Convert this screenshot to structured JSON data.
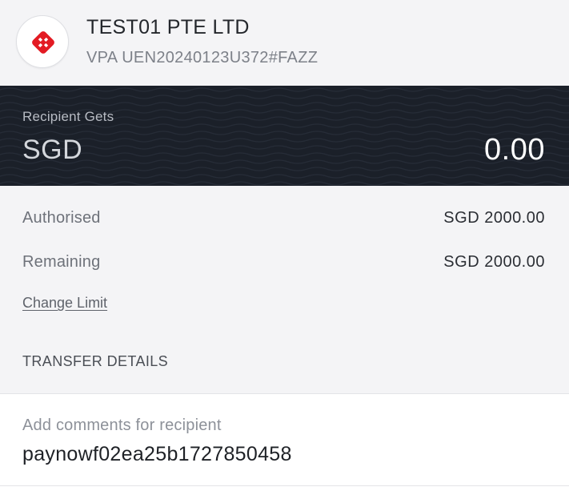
{
  "recipient": {
    "name": "TEST01 PTE LTD",
    "vpa": "VPA UEN20240123U372#FAZZ",
    "logo_icon": "dbs-logo-icon",
    "logo_color": "#e31b23"
  },
  "amount_band": {
    "label": "Recipient Gets",
    "currency": "SGD",
    "amount": "0.00",
    "background_color": "#1b2029"
  },
  "limits": {
    "authorised_label": "Authorised",
    "authorised_value": "SGD 2000.00",
    "remaining_label": "Remaining",
    "remaining_value": "SGD 2000.00",
    "change_limit_label": "Change Limit"
  },
  "transfer_details": {
    "title": "TRANSFER DETAILS",
    "comments_label": "Add comments for recipient",
    "comments_value": "paynowf02ea25b1727850458"
  }
}
